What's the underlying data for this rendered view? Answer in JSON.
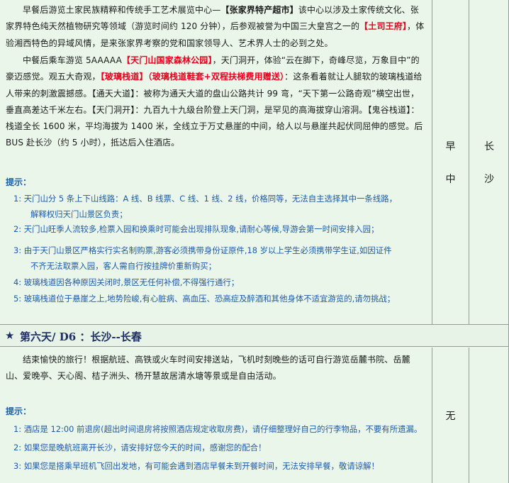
{
  "day5": {
    "paragraphs": [
      [
        {
          "t": "早餐后游览土家民族精粹和传统手工艺术展览中心—"
        },
        {
          "t": "【张家界特产超市】",
          "c": "bold"
        },
        {
          "t": "该中心以涉及土家传统文化、张家界特色纯天然植物研究等领域（游览时间约 120 分钟），后参观被誉为中国三大皇宫之一的"
        },
        {
          "t": "【土司王府】",
          "c": "red"
        },
        {
          "t": "，体验湘西特色的异域风情，是来张家界考察的党和国家领导人、艺术界人士的必到之处。"
        }
      ],
      [
        {
          "t": "中餐后乘车游览 5AAAAA"
        },
        {
          "t": "【天门山国家森林公园】",
          "c": "red"
        },
        {
          "t": "，天门洞开，体验“云在脚下，奇峰尽览，万象目中”的豪迈感觉。观五大奇观，"
        },
        {
          "t": "【玻璃栈道】",
          "c": "red"
        },
        {
          "t": "（玻璃栈道鞋套+双程扶梯费用赠送）",
          "c": "red"
        },
        {
          "t": "：这条看着就让人腿软的玻璃栈道给人带来的刺激震撼感。【通天大道】：被称为通天大道的盘山公路共计 99 弯，“天下第一公路奇观”横空出世，垂直高差达千米左右。【天门洞开】：九百九十九级台阶登上天门洞，是罕见的高海拔穿山溶洞。【鬼谷栈道】：栈道全长 1600 米，平均海拔为 1400 米，全线立于万丈悬崖的中间，给人以与悬崖共起伏同屈伸的感觉。后 BUS 赴长沙（约 5 小时），抵达后入住酒店。"
        }
      ]
    ],
    "tips_title": "提示：",
    "tips": [
      {
        "num": "1:",
        "line1": "天门山分 5 条上下山线路：A 线、B 线票、C 线、1 线、2 线，价格同等，无法自主选择其中一条线路，",
        "line2": "解释权归天门山景区负责；"
      },
      {
        "num": "2:",
        "line1": "天门山旺季人流较多,检票入园和换乘时可能会出现排队现象,请耐心等候,导游会第一时间安排入园；",
        "line2": ""
      },
      {
        "num": "3:",
        "line1": "由于天门山景区严格实行实名制购票,游客必须携带身份证原件,18  岁以上学生必须携带学生证,如因证件",
        "line2": "不齐无法取票入园，客人需自行按挂牌价重新购买；"
      },
      {
        "num": "4:",
        "line1": "玻璃栈道因各种原因关闭时,景区无任何补偿,不得强行通行；",
        "line2": ""
      },
      {
        "num": "5:",
        "line1": "玻璃栈道位于悬崖之上,地势险峻,有心脏病、高血压、恐高症及醉酒和其他身体不适宜游览的,请勿挑战；",
        "line2": ""
      }
    ],
    "meals": [
      "早",
      "中"
    ],
    "stay": [
      "长",
      "沙"
    ]
  },
  "day6": {
    "header_star": "★",
    "header_title": "第六天/ D6 ：长沙--长春",
    "paragraph": "结束愉快的旅行！根据航班、高铁或火车时间安排送站，飞机时刻晚些的话可自行游览岳麓书院、岳麓山、爱晚亭、天心阁、桔子洲头、杨开慧故居清水塘等景或是自由活动。",
    "tips_title": "提示：",
    "tips": [
      {
        "num": "1:",
        "line1": "酒店是 12:00 前退房(超出时间退房将按照酒店规定收取房费)，请仔细整理好自己的行李物品，不要有所遗漏。"
      },
      {
        "num": "2:",
        "line1": "如果您是晚航班离开长沙，请安排好您今天的时间，感谢您的配合！"
      },
      {
        "num": "3:",
        "line1": "如果您是搭乘早班机飞回出发地，有可能会遇到酒店早餐未到开餐时间，无法安排早餐，敬请谅解！"
      }
    ],
    "meals": "无"
  }
}
